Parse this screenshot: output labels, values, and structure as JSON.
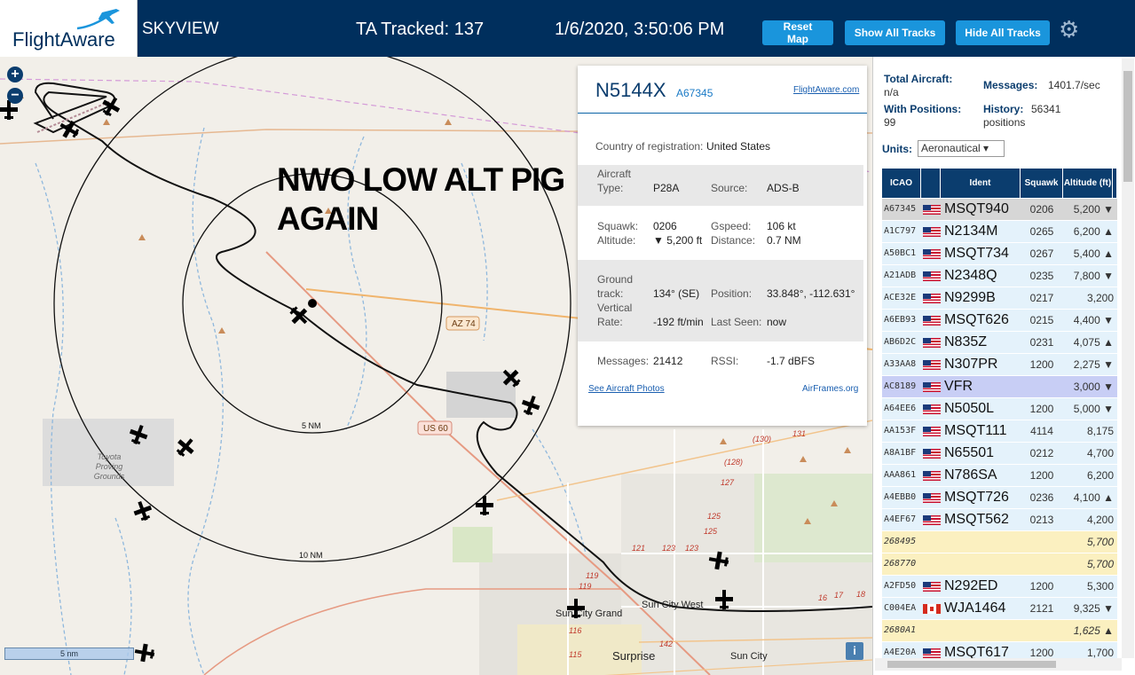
{
  "header": {
    "logo_text": "FlightAware",
    "title": "SKYVIEW",
    "tracked": "TA Tracked: 137",
    "datetime": "1/6/2020, 3:50:06 PM",
    "buttons": {
      "reset": "Reset Map",
      "show": "Show All Tracks",
      "hide": "Hide All Tracks"
    },
    "settings_icon": "gear-icon"
  },
  "map": {
    "annotation_line1": "NWO LOW ALT PIG",
    "annotation_line2": "AGAIN",
    "zoom_in": "+",
    "zoom_out": "−",
    "scale_label": "5 nm",
    "info_label": "i",
    "ring_labels": [
      "5 NM",
      "10 NM"
    ],
    "road_labels": [
      "AZ 74",
      "US 60"
    ],
    "place_labels": [
      "Toyota",
      "Proving",
      "Grounds",
      "Sun City Grand",
      "Sun City West",
      "Surprise",
      "Sun City"
    ],
    "route_numbers": [
      "(130)",
      "131",
      "(128)",
      "127",
      "125",
      "125",
      "123",
      "123",
      "121",
      "119",
      "119",
      "116",
      "115",
      "142",
      "17",
      "16",
      "18"
    ]
  },
  "popup": {
    "registration": "N5144X",
    "icao": "A67345",
    "fa_link": "FlightAware.com",
    "country_label": "Country of registration:",
    "country": "United States",
    "aircraft_type_label": "Aircraft Type:",
    "aircraft_label_1": "Aircraft",
    "aircraft_label_2": "Type:",
    "aircraft_type": "P28A",
    "source_label": "Source:",
    "source": "ADS-B",
    "squawk_label": "Squawk:",
    "squawk": "0206",
    "gspeed_label": "Gspeed:",
    "gspeed": "106 kt",
    "altitude_label": "Altitude:",
    "altitude": "▼ 5,200 ft",
    "distance_label": "Distance:",
    "distance": "0.7 NM",
    "ground_track_label_1": "Ground",
    "ground_track_label_2": "track:",
    "ground_track": "134° (SE)",
    "position_label": "Position:",
    "position": "33.848°, -112.631°",
    "vrate_label_1": "Vertical",
    "vrate_label_2": "Rate:",
    "vrate": "-192 ft/min",
    "last_seen_label": "Last Seen:",
    "last_seen": "now",
    "messages_label": "Messages:",
    "messages": "21412",
    "rssi_label": "RSSI:",
    "rssi": "-1.7 dBFS",
    "photos_link": "See Aircraft Photos",
    "airframes_link": "AirFrames.org"
  },
  "panel": {
    "total_aircraft_label": "Total Aircraft:",
    "total_aircraft": "n/a",
    "messages_label": "Messages:",
    "messages": "1401.7/sec",
    "with_positions_label": "With Positions:",
    "with_positions": "99",
    "history_label": "History:",
    "history": "56341",
    "history_unit": "positions",
    "units_label": "Units:",
    "units_value": "Aeronautical ▾",
    "columns": [
      "ICAO",
      "Ident",
      "Squawk",
      "Altitude (ft)"
    ],
    "rows": [
      {
        "icao": "A67345",
        "flag": "us",
        "ident": "MSQT940",
        "squawk": "0206",
        "alt": "5,200 ▼",
        "style": "selected"
      },
      {
        "icao": "A1C797",
        "flag": "us",
        "ident": "N2134M",
        "squawk": "0265",
        "alt": "6,200 ▲",
        "style": "normal"
      },
      {
        "icao": "A50BC1",
        "flag": "us",
        "ident": "MSQT734",
        "squawk": "0267",
        "alt": "5,400 ▲",
        "style": "normal"
      },
      {
        "icao": "A21ADB",
        "flag": "us",
        "ident": "N2348Q",
        "squawk": "0235",
        "alt": "7,800 ▼",
        "style": "normal"
      },
      {
        "icao": "ACE32E",
        "flag": "us",
        "ident": "N9299B",
        "squawk": "0217",
        "alt": "3,200",
        "style": "normal"
      },
      {
        "icao": "A6EB93",
        "flag": "us",
        "ident": "MSQT626",
        "squawk": "0215",
        "alt": "4,400 ▼",
        "style": "normal"
      },
      {
        "icao": "AB6D2C",
        "flag": "us",
        "ident": "N835Z",
        "squawk": "0231",
        "alt": "4,075 ▲",
        "style": "normal"
      },
      {
        "icao": "A33AA8",
        "flag": "us",
        "ident": "N307PR",
        "squawk": "1200",
        "alt": "2,275 ▼",
        "style": "normal"
      },
      {
        "icao": "AC8189",
        "flag": "us",
        "ident": "VFR",
        "squawk": "",
        "alt": "3,000 ▼",
        "style": "vfr"
      },
      {
        "icao": "A64EE6",
        "flag": "us",
        "ident": "N5050L",
        "squawk": "1200",
        "alt": "5,000 ▼",
        "style": "normal"
      },
      {
        "icao": "AA153F",
        "flag": "us",
        "ident": "MSQT111",
        "squawk": "4114",
        "alt": "8,175",
        "style": "normal"
      },
      {
        "icao": "A8A1BF",
        "flag": "us",
        "ident": "N65501",
        "squawk": "0212",
        "alt": "4,700",
        "style": "normal"
      },
      {
        "icao": "AAA861",
        "flag": "us",
        "ident": "N786SA",
        "squawk": "1200",
        "alt": "6,200",
        "style": "normal"
      },
      {
        "icao": "A4EBB0",
        "flag": "us",
        "ident": "MSQT726",
        "squawk": "0236",
        "alt": "4,100 ▲",
        "style": "normal"
      },
      {
        "icao": "A4EF67",
        "flag": "us",
        "ident": "MSQT562",
        "squawk": "0213",
        "alt": "4,200",
        "style": "normal"
      },
      {
        "icao": "268495",
        "flag": "",
        "ident": "",
        "squawk": "",
        "alt": "5,700",
        "style": "mlat"
      },
      {
        "icao": "268770",
        "flag": "",
        "ident": "",
        "squawk": "",
        "alt": "5,700",
        "style": "mlat"
      },
      {
        "icao": "A2FD50",
        "flag": "us",
        "ident": "N292ED",
        "squawk": "1200",
        "alt": "5,300",
        "style": "normal"
      },
      {
        "icao": "C004EA",
        "flag": "ca",
        "ident": "WJA1464",
        "squawk": "2121",
        "alt": "9,325 ▼",
        "style": "normal"
      },
      {
        "icao": "2680A1",
        "flag": "",
        "ident": "",
        "squawk": "",
        "alt": "1,625 ▲",
        "style": "mlat"
      },
      {
        "icao": "A4E20A",
        "flag": "us",
        "ident": "MSQT617",
        "squawk": "1200",
        "alt": "1,700",
        "style": "normal"
      }
    ]
  },
  "colors": {
    "header_bg": "#002f5d",
    "button": "#1a95dc",
    "row_normal": "#e4f2fb",
    "row_selected": "#d6d6d6",
    "row_vfr": "#c8cef5",
    "row_mlat": "#fbf0c0"
  }
}
